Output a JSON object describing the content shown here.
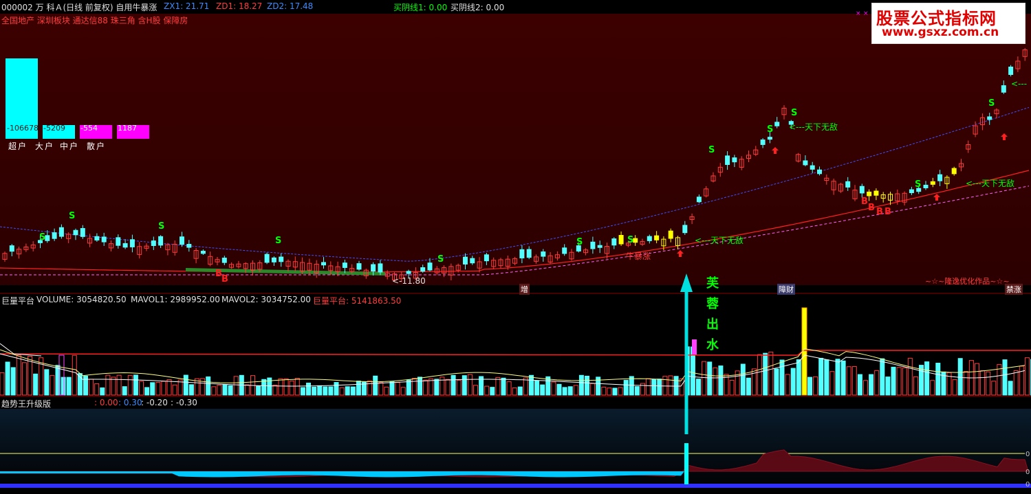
{
  "header": {
    "stock": "000002 万 科Ａ(日线 前复权) 自用牛暴涨",
    "zx1": "ZX1: 21.71",
    "zd1": "ZD1: 18.27",
    "zd2": "ZD2: 17.48",
    "buy1": "买阴线1: 0.00",
    "buy2": "买阴线2: 0.00",
    "concepts": "全国地产 深圳板块 通达信88 珠三角 含H股 保障房"
  },
  "logo": {
    "line1": "股票公式指标网",
    "line2": "www.gsxz.com.cn"
  },
  "money_flow": {
    "bars": [
      {
        "label": "超户",
        "value": "-106678",
        "color": "#00ffff"
      },
      {
        "label": "大户",
        "value": "-5209",
        "color": "#00ffff"
      },
      {
        "label": "中户",
        "value": "-554",
        "color": "#ff00ff"
      },
      {
        "label": "散户",
        "value": "1187",
        "color": "#ff00ff"
      }
    ]
  },
  "annotations": {
    "tianxia": "天下无敌",
    "niubaozhang": "牛暴涨",
    "low_price": "11.80",
    "author": "~☆~隆逸优化作品~☆~",
    "furong": [
      "芙",
      "蓉",
      "出",
      "水"
    ],
    "mark_zeng": "增",
    "mark_zhangcai": "障财",
    "mark_zhangzhang": "禁涨"
  },
  "volume_panel": {
    "name": "巨量平台",
    "volume": "VOLUME: 3054820.50",
    "mavol1": "MAVOL1: 2989952.00",
    "mavol2": "MAVOL2: 3034752.00",
    "juliang": "巨量平台: 5141863.50"
  },
  "trend_panel": {
    "name": "趋势王升级版",
    "v1": ": 0.00",
    "v2": ": 0.30",
    "v3": ": -0.20",
    "v4": ": -0.30"
  },
  "colors": {
    "up": "#ff3c3c",
    "down": "#54ffff",
    "accent": "#ffff00",
    "bg_price": "#3a0000"
  }
}
